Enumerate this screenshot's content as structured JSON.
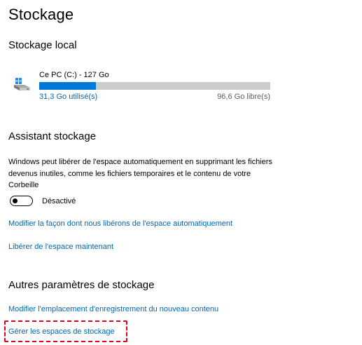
{
  "page": {
    "title": "Stockage"
  },
  "local": {
    "heading": "Stockage local",
    "drive": {
      "icon": "windows-drive-icon",
      "name": "Ce PC (C:) - 127 Go",
      "used_label": "31,3 Go utilisé(s)",
      "free_label": "96,6 Go libre(s)",
      "used_fraction": 0.246
    }
  },
  "assistant": {
    "heading": "Assistant stockage",
    "description": "Windows peut libérer de l'espace automatiquement en supprimant les fichiers devenus inutiles, comme les fichiers temporaires et le contenu de votre Corbeille",
    "toggle": {
      "state": "off",
      "label": "Désactivé"
    },
    "link_modify": "Modifier la façon dont nous libérons de l'espace automatiquement",
    "link_free_now": "Libérer de l'espace maintenant"
  },
  "other": {
    "heading": "Autres paramètres de stockage",
    "link_location": "Modifier l'emplacement d'enregistrement du nouveau contenu",
    "link_spaces": "Gérer les espaces de stockage"
  },
  "colors": {
    "accent": "#0078d7",
    "link": "#0066b4",
    "bar_track": "#cccccc",
    "highlight": "#e0001b"
  }
}
